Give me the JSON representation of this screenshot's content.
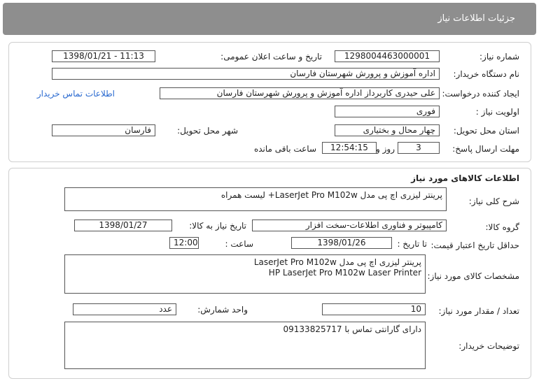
{
  "header": {
    "title": "جزئیات اطلاعات نیاز"
  },
  "info": {
    "need_number_label": "شماره نیاز:",
    "need_number": "1298004463000001",
    "announce_label": "تاریخ و ساعت اعلان عمومی:",
    "announce_value": "1398/01/21 - 11:13",
    "buyer_org_label": "نام دستگاه خریدار:",
    "buyer_org": "اداره آموزش و پرورش شهرستان فارسان",
    "requester_label": "ایجاد کننده درخواست:",
    "requester": "علی حیدری کاربرداز اداره آموزش و پرورش شهرستان فارسان",
    "contact_link": "اطلاعات تماس خریدار",
    "priority_label": "اولویت نیاز :",
    "priority": "فوری",
    "province_label": "استان محل تحویل:",
    "province": "چهار محال و بختیاری",
    "city_label": "شهر محل تحویل:",
    "city": "فارسان",
    "deadline_label": "مهلت ارسال پاسخ:",
    "days": "3",
    "days_label": "روز و",
    "time_left": "12:54:15",
    "time_left_label": "ساعت باقی مانده"
  },
  "goods": {
    "section_title": "اطلاعات کالاهای مورد نیاز",
    "desc_label": "شرح کلی نیاز:",
    "desc": "پرینتر لیزری اچ پی مدل LaserJet Pro M102w+ لیست همراه",
    "group_label": "گروه کالا:",
    "group": "کامپیوتر و فناوری اطلاعات-سخت افزار",
    "need_date_label": "تاریخ نیاز به کالا:",
    "need_date": "1398/01/27",
    "validity_label": "حداقل تاریخ اعتبار قیمت:",
    "to_date_label": "تا تاریخ :",
    "to_date": "1398/01/26",
    "time_label": "ساعت :",
    "time": "12:00",
    "spec_label": "مشخصات کالای مورد نیاز:",
    "spec_line1": "پرینتر لیزری اچ پی مدل LaserJet Pro M102w",
    "spec_line2": "HP LaserJet Pro M102w Laser Printer",
    "qty_label": "تعداد / مقدار مورد نیاز:",
    "qty": "10",
    "unit_label": "واحد شمارش:",
    "unit": "عدد",
    "notes_label": "توضیحات خریدار:",
    "notes": "دارای گارانتی تماس با 09133825717"
  }
}
